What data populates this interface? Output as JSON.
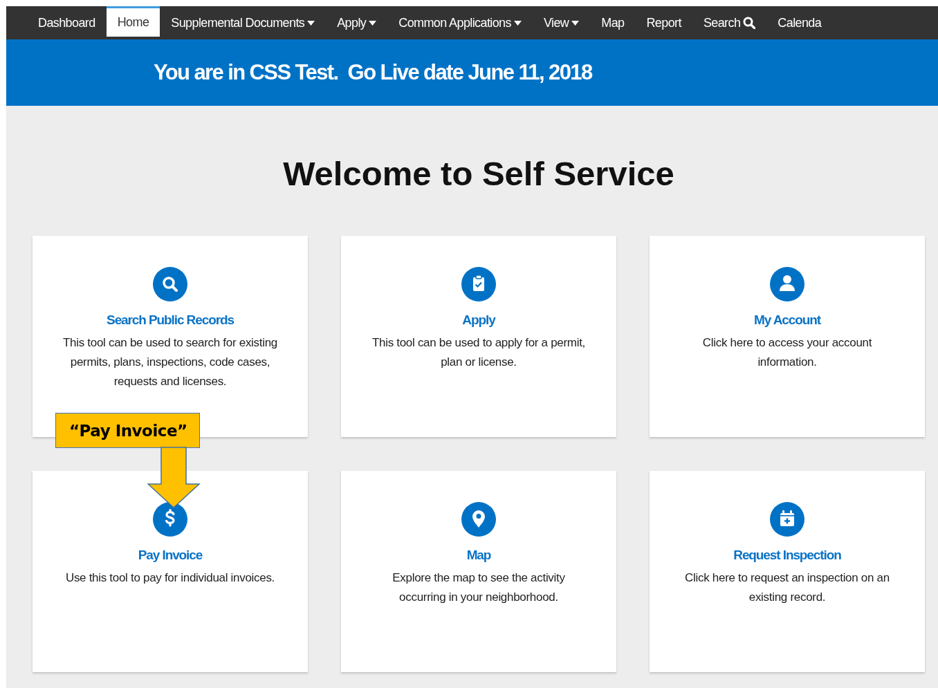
{
  "nav": {
    "items": [
      {
        "label": "Dashboard",
        "kind": "link",
        "selected": false
      },
      {
        "label": "Home",
        "kind": "link",
        "selected": true
      },
      {
        "label": "Supplemental Documents",
        "kind": "dropdown",
        "selected": false
      },
      {
        "label": "Apply",
        "kind": "dropdown",
        "selected": false
      },
      {
        "label": "Common Applications",
        "kind": "dropdown",
        "selected": false
      },
      {
        "label": "View",
        "kind": "dropdown",
        "selected": false
      },
      {
        "label": "Map",
        "kind": "link",
        "selected": false
      },
      {
        "label": "Report",
        "kind": "link",
        "selected": false
      },
      {
        "label": "Search",
        "kind": "search",
        "selected": false
      },
      {
        "label": "Calenda",
        "kind": "link",
        "selected": false
      }
    ]
  },
  "banner": {
    "text": "You are in CSS Test.  Go Live date June 11, 2018"
  },
  "heading": "Welcome to Self Service",
  "cards": [
    {
      "title": "Search Public Records",
      "description": "This tool can be used to search for existing permits, plans, inspections, code cases, requests and licenses."
    },
    {
      "title": "Apply",
      "description": "This tool can be used to apply for a permit, plan or license."
    },
    {
      "title": "My Account",
      "description": "Click here to access your account information."
    },
    {
      "title": "Pay Invoice",
      "description": "Use this tool to pay for individual invoices."
    },
    {
      "title": "Map",
      "description": "Explore the map to see the activity occurring in your neighborhood."
    },
    {
      "title": "Request Inspection",
      "description": "Click here to request an inspection on an existing record."
    }
  ],
  "callout": {
    "text": "“Pay Invoice”"
  }
}
